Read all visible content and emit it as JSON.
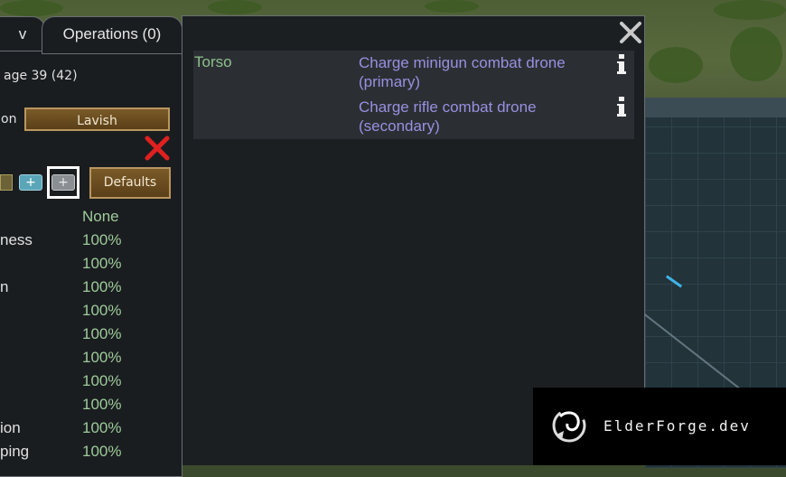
{
  "tabs": [
    {
      "label": "v"
    },
    {
      "label": "Operations (0)"
    }
  ],
  "overview": {
    "age_text": "age 39 (42)",
    "food_label": "on",
    "food_button": "Lavish",
    "defaults_button": "Defaults"
  },
  "capacities": [
    {
      "name": "",
      "value": "None"
    },
    {
      "name": "ness",
      "value": "100%"
    },
    {
      "name": "",
      "value": "100%"
    },
    {
      "name": "n",
      "value": "100%"
    },
    {
      "name": "",
      "value": "100%"
    },
    {
      "name": "",
      "value": "100%"
    },
    {
      "name": "",
      "value": "100%"
    },
    {
      "name": "",
      "value": "100%"
    },
    {
      "name": "",
      "value": "100%"
    },
    {
      "name": "ion",
      "value": "100%"
    },
    {
      "name": "ping",
      "value": "100%"
    }
  ],
  "implants": [
    {
      "part": "Torso",
      "operation": "Charge minigun combat drone (primary)"
    },
    {
      "part": "",
      "operation": "Charge rifle combat drone (secondary)"
    }
  ],
  "watermark": {
    "text": "ElderForge.dev"
  },
  "colors": {
    "panel_bg": "#1c1f22",
    "row_bg": "#2b2f33",
    "part_text": "#8fbf8c",
    "operation_text": "#9a8fe0",
    "value_text": "#9ecb9a",
    "button_gold": "#7a5a28"
  }
}
